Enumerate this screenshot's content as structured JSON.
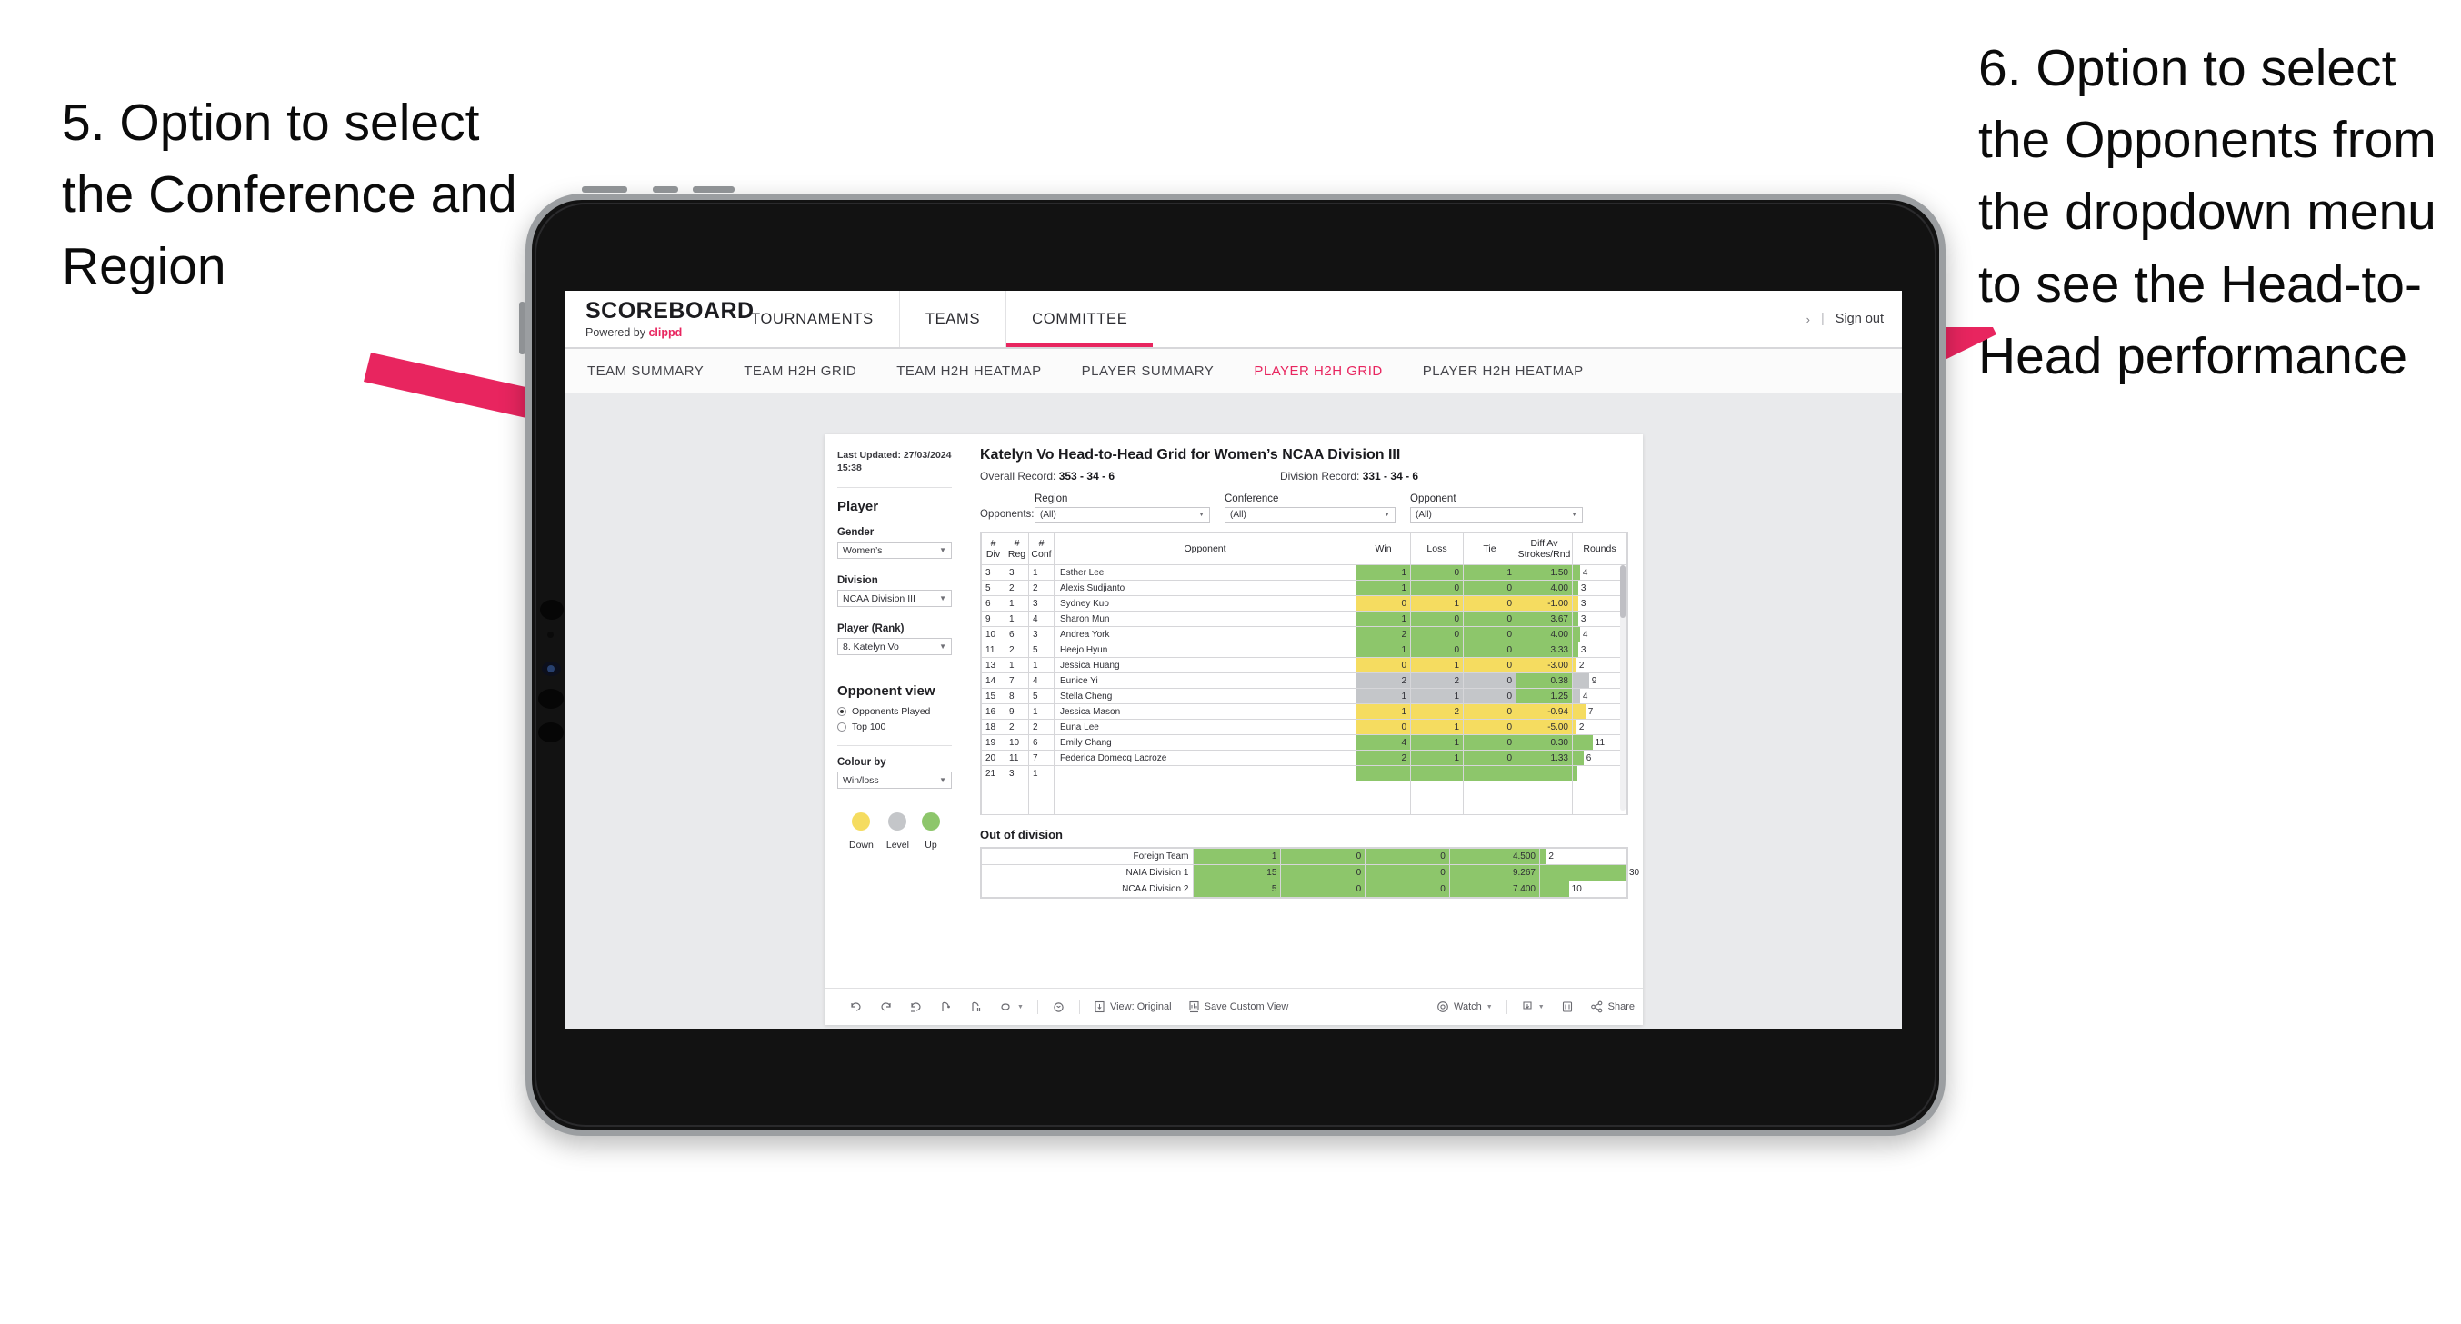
{
  "annotations": {
    "left": "5. Option to select the Conference and Region",
    "right": "6. Option to select the Opponents from the dropdown menu to see the Head-to-Head performance",
    "arrow_color": "#E8255F"
  },
  "topnav": {
    "brand_title": "SCOREBOARD",
    "brand_sub_prefix": "Powered by ",
    "brand_sub_brand": "clippd",
    "items": [
      {
        "label": "TOURNAMENTS",
        "active": false
      },
      {
        "label": "TEAMS",
        "active": false
      },
      {
        "label": "COMMITTEE",
        "active": true
      }
    ],
    "chevron": "›",
    "separator": "|",
    "sign_out": "Sign out"
  },
  "subnav": {
    "items": [
      {
        "label": "TEAM SUMMARY",
        "active": false
      },
      {
        "label": "TEAM H2H GRID",
        "active": false
      },
      {
        "label": "TEAM H2H HEATMAP",
        "active": false
      },
      {
        "label": "PLAYER SUMMARY",
        "active": false
      },
      {
        "label": "PLAYER H2H GRID",
        "active": true
      },
      {
        "label": "PLAYER H2H HEATMAP",
        "active": false
      }
    ]
  },
  "sidebar": {
    "last_updated": "Last Updated: 27/03/2024 15:38",
    "section_player": "Player",
    "gender": {
      "label": "Gender",
      "value": "Women’s"
    },
    "division": {
      "label": "Division",
      "value": "NCAA Division III"
    },
    "player_rank": {
      "label": "Player (Rank)",
      "value": "8. Katelyn Vo"
    },
    "opponent_view": {
      "heading": "Opponent view",
      "options": [
        {
          "label": "Opponents Played",
          "selected": true
        },
        {
          "label": "Top 100",
          "selected": false
        }
      ]
    },
    "colour_by": {
      "label": "Colour by",
      "value": "Win/loss"
    },
    "legend": [
      {
        "label": "Down",
        "color": "#F5DC60"
      },
      {
        "label": "Level",
        "color": "#C4C6C9"
      },
      {
        "label": "Up",
        "color": "#8DC66B"
      }
    ]
  },
  "viz": {
    "title": "Katelyn Vo Head-to-Head Grid for Women’s NCAA Division III",
    "overall_record_label": "Overall Record: ",
    "overall_record_value": "353 - 34 - 6",
    "division_record_label": "Division Record: ",
    "division_record_value": "331 -  34 - 6",
    "opponents_label": "Opponents:",
    "filters": [
      {
        "label": "Region",
        "value": "(All)"
      },
      {
        "label": "Conference",
        "value": "(All)"
      },
      {
        "label": "Opponent",
        "value": "(All)"
      }
    ],
    "out_of_division_title": "Out of division"
  },
  "chart_data": {
    "type": "table",
    "title": "Katelyn Vo Head-to-Head Grid for Women’s NCAA Division III",
    "columns": [
      "# Div",
      "# Reg",
      "# Conf",
      "Opponent",
      "Win",
      "Loss",
      "Tie",
      "Diff Av Strokes/Rnd",
      "Rounds"
    ],
    "column_headers_multiline": [
      {
        "top": "#",
        "bottom": "Div"
      },
      {
        "top": "#",
        "bottom": "Reg"
      },
      {
        "top": "#",
        "bottom": "Conf"
      },
      {
        "top": "",
        "bottom": "Opponent"
      },
      {
        "top": "",
        "bottom": "Win"
      },
      {
        "top": "",
        "bottom": "Loss"
      },
      {
        "top": "",
        "bottom": "Tie"
      },
      {
        "top": "Diff Av",
        "bottom": "Strokes/Rnd"
      },
      {
        "top": "",
        "bottom": "Rounds"
      }
    ],
    "rounds_max": 30,
    "rows": [
      {
        "div": "3",
        "reg": "3",
        "conf": "1",
        "opponent": "Esther Lee",
        "win": "1",
        "loss": "0",
        "tie": "1",
        "diff": "1.50",
        "rounds": "4",
        "rounds_val": 4,
        "state": "up"
      },
      {
        "div": "5",
        "reg": "2",
        "conf": "2",
        "opponent": "Alexis Sudjianto",
        "win": "1",
        "loss": "0",
        "tie": "0",
        "diff": "4.00",
        "rounds": "3",
        "rounds_val": 3,
        "state": "up"
      },
      {
        "div": "6",
        "reg": "1",
        "conf": "3",
        "opponent": "Sydney Kuo",
        "win": "0",
        "loss": "1",
        "tie": "0",
        "diff": "-1.00",
        "rounds": "3",
        "rounds_val": 3,
        "state": "down"
      },
      {
        "div": "9",
        "reg": "1",
        "conf": "4",
        "opponent": "Sharon Mun",
        "win": "1",
        "loss": "0",
        "tie": "0",
        "diff": "3.67",
        "rounds": "3",
        "rounds_val": 3,
        "state": "up"
      },
      {
        "div": "10",
        "reg": "6",
        "conf": "3",
        "opponent": "Andrea York",
        "win": "2",
        "loss": "0",
        "tie": "0",
        "diff": "4.00",
        "rounds": "4",
        "rounds_val": 4,
        "state": "up"
      },
      {
        "div": "11",
        "reg": "2",
        "conf": "5",
        "opponent": "Heejo Hyun",
        "win": "1",
        "loss": "0",
        "tie": "0",
        "diff": "3.33",
        "rounds": "3",
        "rounds_val": 3,
        "state": "up"
      },
      {
        "div": "13",
        "reg": "1",
        "conf": "1",
        "opponent": "Jessica Huang",
        "win": "0",
        "loss": "1",
        "tie": "0",
        "diff": "-3.00",
        "rounds": "2",
        "rounds_val": 2,
        "state": "down"
      },
      {
        "div": "14",
        "reg": "7",
        "conf": "4",
        "opponent": "Eunice Yi",
        "win": "2",
        "loss": "2",
        "tie": "0",
        "diff": "0.38",
        "rounds": "9",
        "rounds_val": 9,
        "state": "level",
        "diff_state": "up"
      },
      {
        "div": "15",
        "reg": "8",
        "conf": "5",
        "opponent": "Stella Cheng",
        "win": "1",
        "loss": "1",
        "tie": "0",
        "diff": "1.25",
        "rounds": "4",
        "rounds_val": 4,
        "state": "level",
        "diff_state": "up"
      },
      {
        "div": "16",
        "reg": "9",
        "conf": "1",
        "opponent": "Jessica Mason",
        "win": "1",
        "loss": "2",
        "tie": "0",
        "diff": "-0.94",
        "rounds": "7",
        "rounds_val": 7,
        "state": "down"
      },
      {
        "div": "18",
        "reg": "2",
        "conf": "2",
        "opponent": "Euna Lee",
        "win": "0",
        "loss": "1",
        "tie": "0",
        "diff": "-5.00",
        "rounds": "2",
        "rounds_val": 2,
        "state": "down"
      },
      {
        "div": "19",
        "reg": "10",
        "conf": "6",
        "opponent": "Emily Chang",
        "win": "4",
        "loss": "1",
        "tie": "0",
        "diff": "0.30",
        "rounds": "11",
        "rounds_val": 11,
        "state": "up"
      },
      {
        "div": "20",
        "reg": "11",
        "conf": "7",
        "opponent": "Federica Domecq Lacroze",
        "win": "2",
        "loss": "1",
        "tie": "0",
        "diff": "1.33",
        "rounds": "6",
        "rounds_val": 6,
        "state": "up"
      }
    ],
    "out_of_division": {
      "rounds_max": 30,
      "rows": [
        {
          "name": "Foreign Team",
          "win": "1",
          "loss": "0",
          "tie": "0",
          "diff": "4.500",
          "rounds": "2",
          "rounds_val": 2,
          "state": "up"
        },
        {
          "name": "NAIA Division 1",
          "win": "15",
          "loss": "0",
          "tie": "0",
          "diff": "9.267",
          "rounds": "30",
          "rounds_val": 30,
          "state": "up"
        },
        {
          "name": "NCAA Division 2",
          "win": "5",
          "loss": "0",
          "tie": "0",
          "diff": "7.400",
          "rounds": "10",
          "rounds_val": 10,
          "state": "up"
        }
      ]
    }
  },
  "toolbar": {
    "undo": "undo-icon",
    "redo": "redo-icon",
    "revert": "revert-icon",
    "refresh": "refresh-data-icon",
    "pause": "pause-updates-icon",
    "highlight": "highlight-icon",
    "alerts": "alerts-icon",
    "view_original": "View: Original",
    "save_custom_view": "Save Custom View",
    "watch": "Watch",
    "download": "download-icon",
    "fullscreen": "fullscreen-icon",
    "share": "Share"
  },
  "colors": {
    "accent": "#E8255F",
    "up": "#8DC66B",
    "down": "#F5DC60",
    "level": "#C4C6C9",
    "page_bg": "#E9EAEC"
  }
}
